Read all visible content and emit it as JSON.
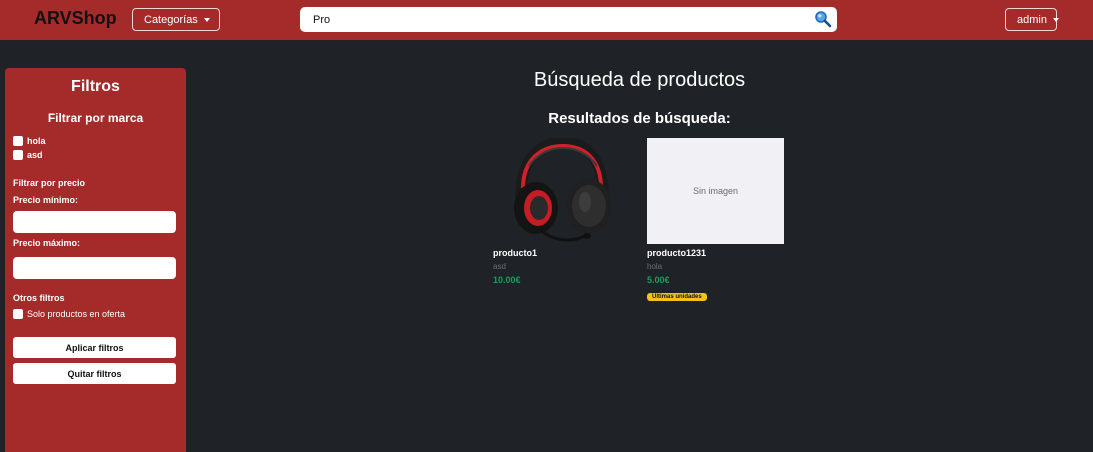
{
  "navbar": {
    "brand": "ARVShop",
    "categories_label": "Categorías",
    "search_value": "Pro",
    "user_label": "admin"
  },
  "sidebar": {
    "title": "Filtros",
    "brand_filter_title": "Filtrar por marca",
    "brands": [
      "hola",
      "asd"
    ],
    "price_filter_title": "Filtrar por precio",
    "min_price_label": "Precio mínimo:",
    "max_price_label": "Precio máximo:",
    "other_filters_title": "Otros filtros",
    "offer_only_label": "Solo productos en oferta",
    "apply_label": "Aplicar filtros",
    "clear_label": "Quitar filtros"
  },
  "main": {
    "title": "Búsqueda de productos",
    "results_title": "Resultados de búsqueda:",
    "products": [
      {
        "name": "producto1",
        "brand": "asd",
        "price": "10.00€",
        "image": "headset-image"
      },
      {
        "name": "producto1231",
        "brand": "hola",
        "price": "5.00€",
        "image_placeholder": "Sin imagen",
        "badge": "Últimas unidades"
      }
    ]
  },
  "colors": {
    "accent": "#a52a2a",
    "background": "#1f2226",
    "price": "#1e9b5e",
    "badge": "#f7c11c"
  }
}
